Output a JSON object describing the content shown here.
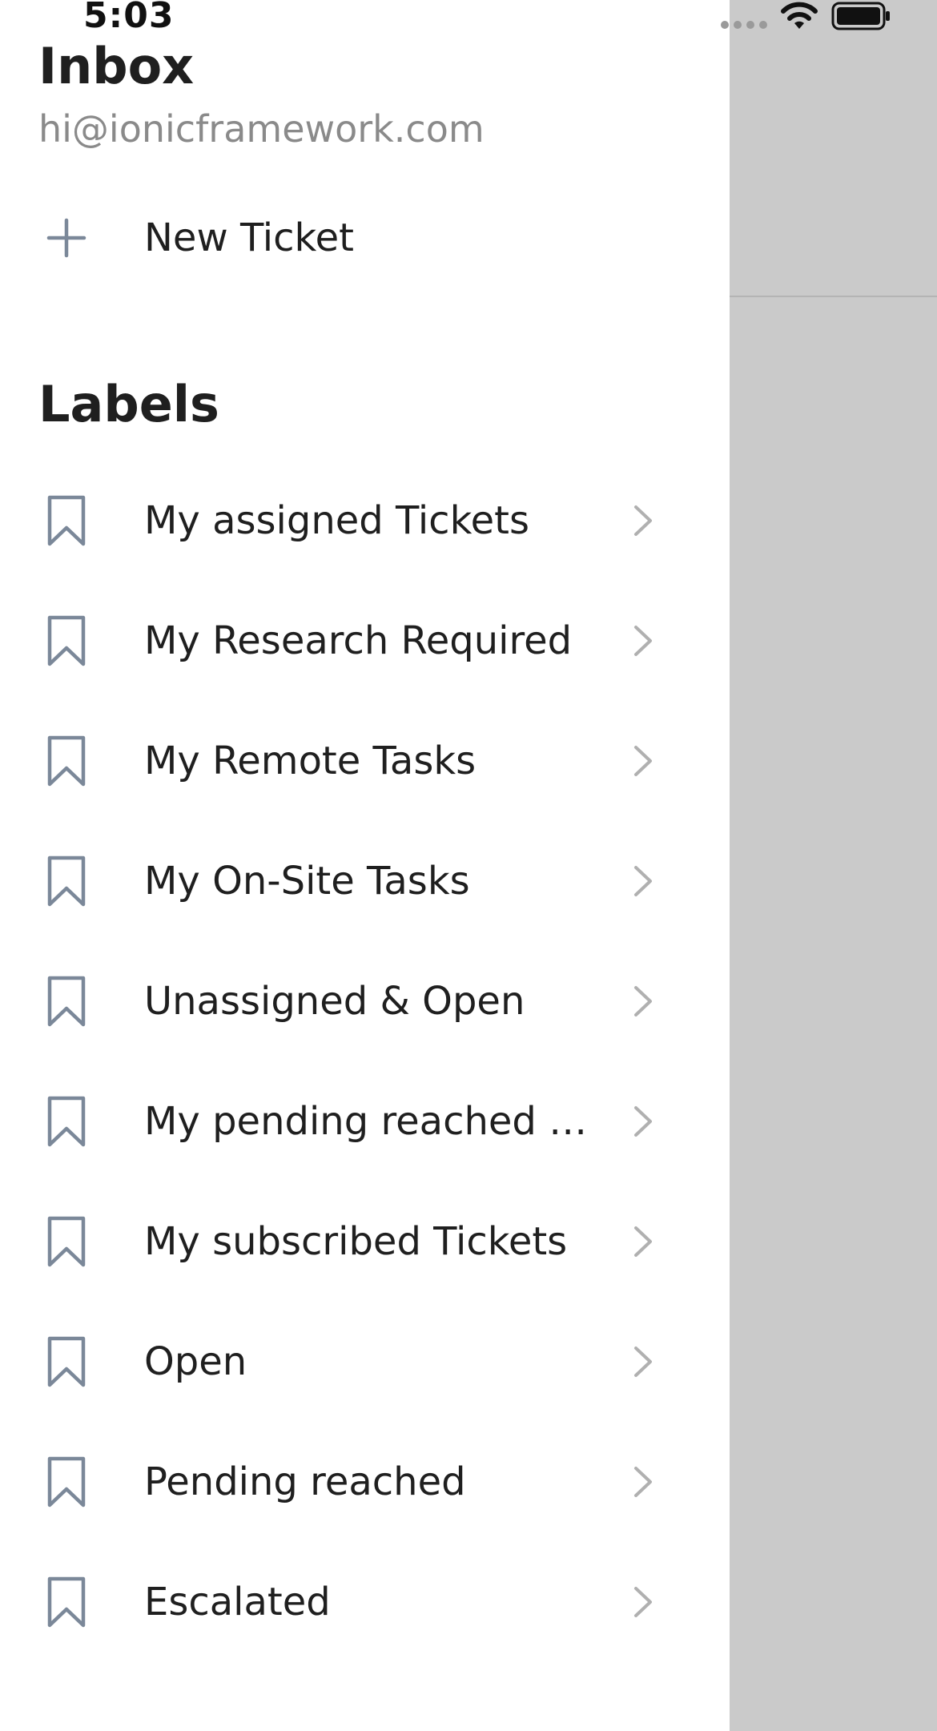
{
  "status_bar": {
    "time": "5:03"
  },
  "menu": {
    "title": "Inbox",
    "email": "hi@ionicframework.com",
    "new_ticket": {
      "label": "New Ticket",
      "icon": "plus-icon"
    },
    "labels_heading": "Labels",
    "label_items": [
      {
        "label": "My assigned Tickets",
        "icon": "bookmark-icon"
      },
      {
        "label": "My Research Required",
        "icon": "bookmark-icon"
      },
      {
        "label": "My Remote Tasks",
        "icon": "bookmark-icon"
      },
      {
        "label": "My On-Site Tasks",
        "icon": "bookmark-icon"
      },
      {
        "label": "Unassigned & Open",
        "icon": "bookmark-icon"
      },
      {
        "label": "My pending reached Tickets",
        "icon": "bookmark-icon"
      },
      {
        "label": "My subscribed Tickets",
        "icon": "bookmark-icon"
      },
      {
        "label": "Open",
        "icon": "bookmark-icon"
      },
      {
        "label": "Pending reached",
        "icon": "bookmark-icon"
      },
      {
        "label": "Escalated",
        "icon": "bookmark-icon"
      }
    ]
  },
  "colors": {
    "icon": "#7b8899",
    "chevron": "#b0b0b0",
    "backdrop": "#cacaca"
  }
}
